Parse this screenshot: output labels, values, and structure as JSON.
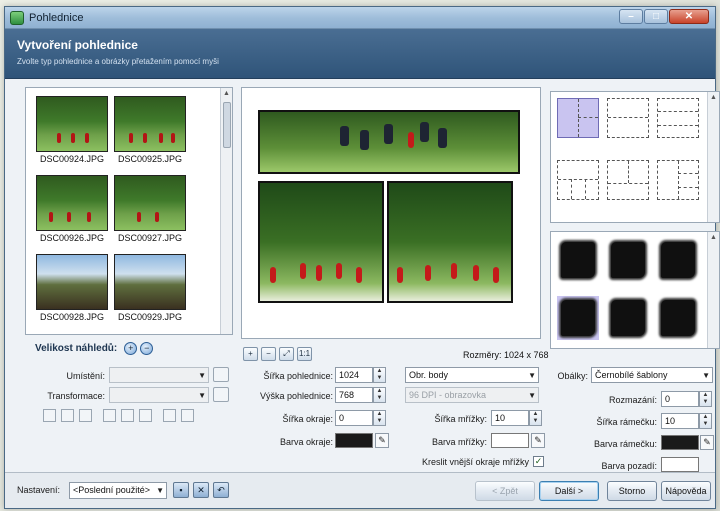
{
  "window": {
    "title": "Pohlednice",
    "controls": {
      "minimize": "–",
      "maximize": "□",
      "close": "✕"
    }
  },
  "header": {
    "title": "Vytvoření pohlednice",
    "subtitle": "Zvolte typ pohlednice a obrázky přetažením pomocí myši"
  },
  "thumbnails": [
    {
      "file": "DSC00924.JPG",
      "icon": "photo-thumbnail"
    },
    {
      "file": "DSC00925.JPG",
      "icon": "photo-thumbnail"
    },
    {
      "file": "DSC00926.JPG",
      "icon": "photo-thumbnail"
    },
    {
      "file": "DSC00927.JPG",
      "icon": "photo-thumbnail"
    },
    {
      "file": "DSC00928.JPG",
      "icon": "photo-thumbnail"
    },
    {
      "file": "DSC00929.JPG",
      "icon": "photo-thumbnail"
    }
  ],
  "thumbnail_size": {
    "label": "Velikost náhledů:",
    "zoom_in": "+",
    "zoom_out": "−"
  },
  "preview": {
    "dimensions": "Rozměry: 1024 x 768",
    "tools": [
      "+",
      "−",
      "⤢",
      "1:1"
    ]
  },
  "form": {
    "placement": {
      "label": "Umístění:",
      "value": ""
    },
    "transform": {
      "label": "Transformace:",
      "value": ""
    },
    "width": {
      "label": "Šířka pohlednice:",
      "value": "1024"
    },
    "height": {
      "label": "Výška pohlednice:",
      "value": "768"
    },
    "unit": {
      "value": "Obr. body"
    },
    "dpi": {
      "value": "96 DPI - obrazovka"
    },
    "margin_width": {
      "label": "Šířka okraje:",
      "value": "0"
    },
    "margin_color": {
      "label": "Barva okraje:",
      "color": "#1a1a1a"
    },
    "grid_width": {
      "label": "Šířka mřížky:",
      "value": "10"
    },
    "grid_color": {
      "label": "Barva mřížky:",
      "color": "#ffffff"
    },
    "outer_grid": {
      "label": "Kreslit vnější okraje mřížky",
      "checked": true
    },
    "frames": {
      "label": "Obálky:",
      "value": "Černobílé šablony"
    },
    "blur": {
      "label": "Rozmazání:",
      "value": "0"
    },
    "frame_width": {
      "label": "Šířka rámečku:",
      "value": "10"
    },
    "frame_color": {
      "label": "Barva rámečku:",
      "color": "#1a1a1a"
    },
    "background_color": {
      "label": "Barva pozadí:",
      "color": "#ffffff"
    }
  },
  "footer": {
    "settings_label": "Nastavení:",
    "settings_value": "<Poslední použité>",
    "back": "< Zpět",
    "next": "Další >",
    "cancel": "Storno",
    "help": "Nápověda"
  },
  "colors": {
    "header": "#355a80",
    "selected_template": "#c9c4f0",
    "accent_red": "#c41a1a"
  }
}
